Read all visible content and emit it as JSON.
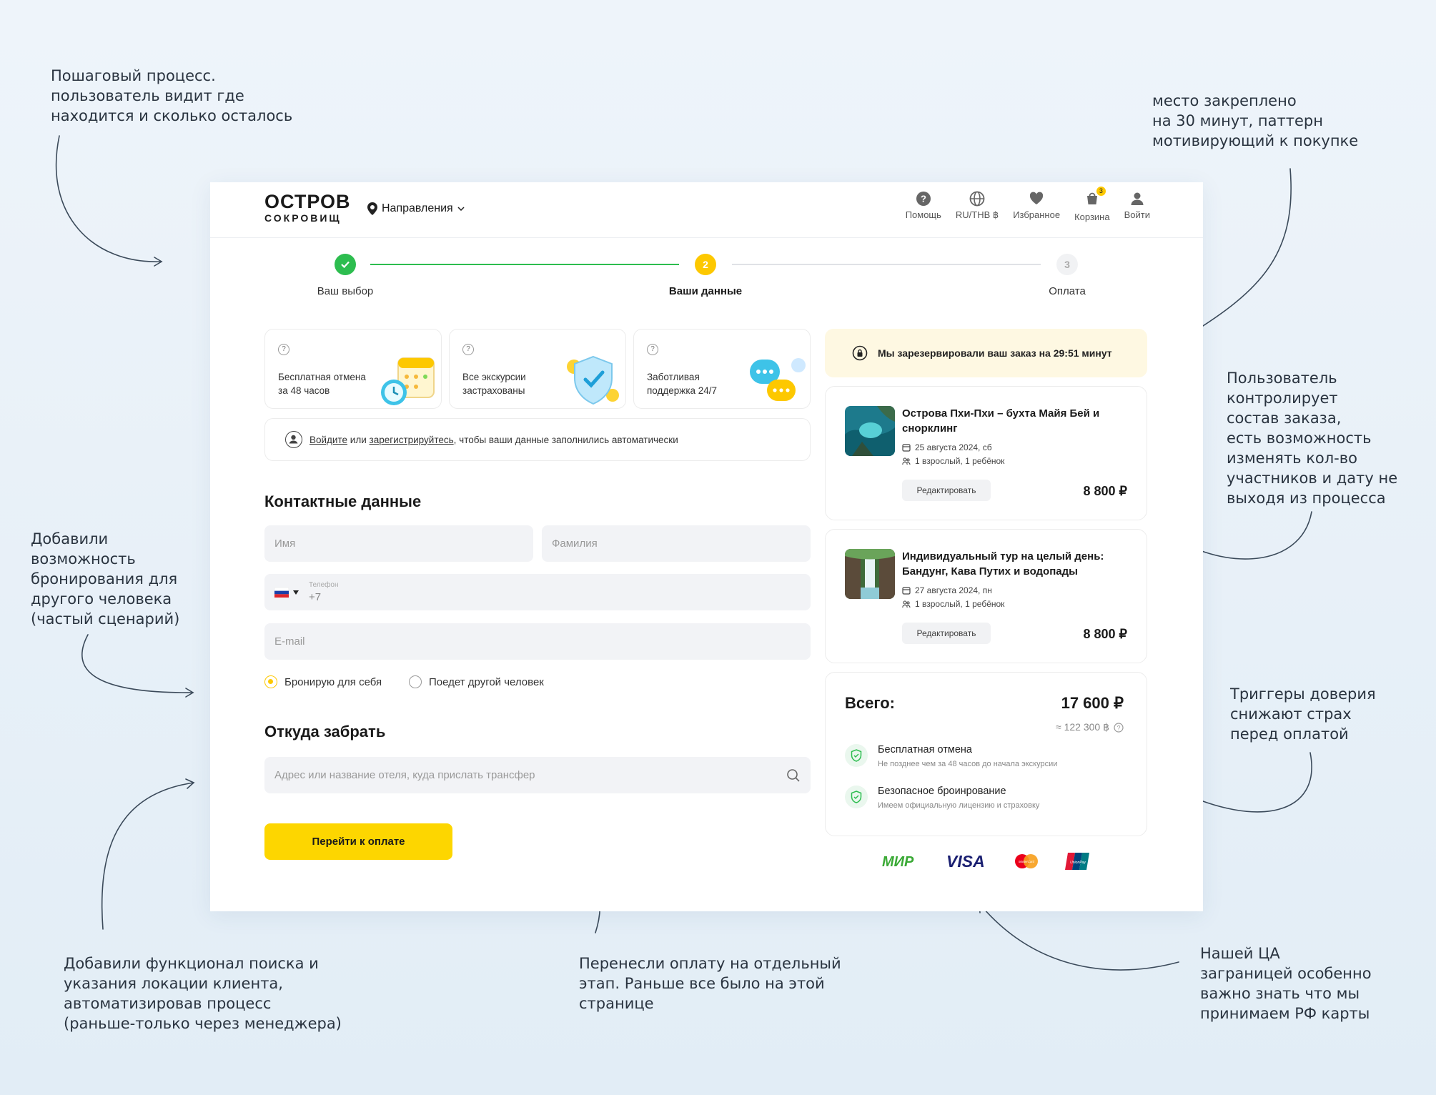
{
  "annotations": {
    "stepper": "Пошаговый процесс.\nпользователь видит где\nнаходится и сколько осталось",
    "timer": "место закреплено\nна 30 минут, паттерн\nмотивирующий к покупке",
    "order": "Пользователь\nконтролирует\nсостав заказа,\nесть возможность\nизменять кол-во\nучастников и дату не\nвыходя из процесса",
    "other_person": "Добавили\nвозможность\nбронирования для\nдругого человека\n(частый сценарий)",
    "trust": "Триггеры доверия\nснижают страх\nперед оплатой",
    "search": "Добавили функционал поиска и\nуказания локации клиента,\nавтоматизировав процесс\n(раньше-только через менеджера)",
    "payment": "Перенесли оплату на отдельный\nэтап. Раньше все было на этой\nстранице",
    "cards": "Нашей ЦА\nзаграницей особенно\nважно знать что мы\nпринимаем РФ карты"
  },
  "header": {
    "logo_line1": "ОСТРОВ",
    "logo_line2": "СОКРОВИЩ",
    "destinations": "Направления",
    "nav": [
      {
        "label": "Помощь",
        "icon": "help-icon"
      },
      {
        "label": "RU/THB ฿",
        "icon": "globe-icon"
      },
      {
        "label": "Избранное",
        "icon": "heart-icon"
      },
      {
        "label": "Корзина",
        "icon": "cart-icon",
        "badge": "3"
      },
      {
        "label": "Войти",
        "icon": "user-icon"
      }
    ]
  },
  "stepper": {
    "steps": [
      {
        "label": "Ваш выбор",
        "state": "done"
      },
      {
        "label": "Ваши данные",
        "num": "2",
        "state": "active"
      },
      {
        "label": "Оплата",
        "num": "3",
        "state": "upcoming"
      }
    ]
  },
  "features": [
    {
      "q": "?",
      "text": "Бесплатная отмена за 48 часов"
    },
    {
      "q": "?",
      "text": "Все экскурсии застрахованы"
    },
    {
      "q": "?",
      "text": "Заботливая поддержка 24/7"
    }
  ],
  "login": {
    "link_login": "Войдите",
    "or": "или",
    "link_register": "зарегистрируйтесь",
    "rest": ", чтобы ваши данные заполнились автоматически"
  },
  "contact": {
    "title": "Контактные данные",
    "first_name_placeholder": "Имя",
    "last_name_placeholder": "Фамилия",
    "phone_label": "Телефон",
    "phone_value": "+7",
    "email_placeholder": "E-mail",
    "radio_self": "Бронирую для себя",
    "radio_other": "Поедет другой человек"
  },
  "pickup": {
    "title": "Откуда забрать",
    "placeholder": "Адрес или название отеля, куда прислать трансфер"
  },
  "cta": "Перейти к оплате",
  "timer": "Мы зарезервировали ваш заказ на 29:51 минут",
  "tours": [
    {
      "title": "Острова Пхи-Пхи – бухта Майя Бей и снорклинг",
      "date": "25 августа 2024, сб",
      "people": "1 взрослый, 1 ребёнок",
      "edit": "Редактировать",
      "price": "8 800 ₽"
    },
    {
      "title": "Индивидуальный тур на целый день: Бандунг, Кава Путих и водопады",
      "date": "27 августа 2024, пн",
      "people": "1 взрослый, 1 ребёнок",
      "edit": "Редактировать",
      "price": "8 800 ₽"
    }
  ],
  "total": {
    "label": "Всего:",
    "amount": "17 600 ₽",
    "thb": "≈ 122 300 ฿",
    "trust": [
      {
        "title": "Бесплатная отмена",
        "sub": "Не позднее чем за 48 часов до начала экскурсии"
      },
      {
        "title": "Безопасное броинрование",
        "sub": "Имеем официальную лицензию и страховку"
      }
    ]
  },
  "payment_logos": [
    {
      "name": "МИР",
      "text": "МИР",
      "color": "#3aa935"
    },
    {
      "name": "VISA",
      "text": "VISA",
      "color": "#1a1f71"
    },
    {
      "name": "Mastercard",
      "text": "MasterCard",
      "color": "#eb001b"
    },
    {
      "name": "UnionPay",
      "text": "UnionPay",
      "color": "#e21836"
    }
  ],
  "colors": {
    "accent": "#fdd600",
    "success": "#2dbd4f",
    "brand_text": "#1a1a1a"
  }
}
